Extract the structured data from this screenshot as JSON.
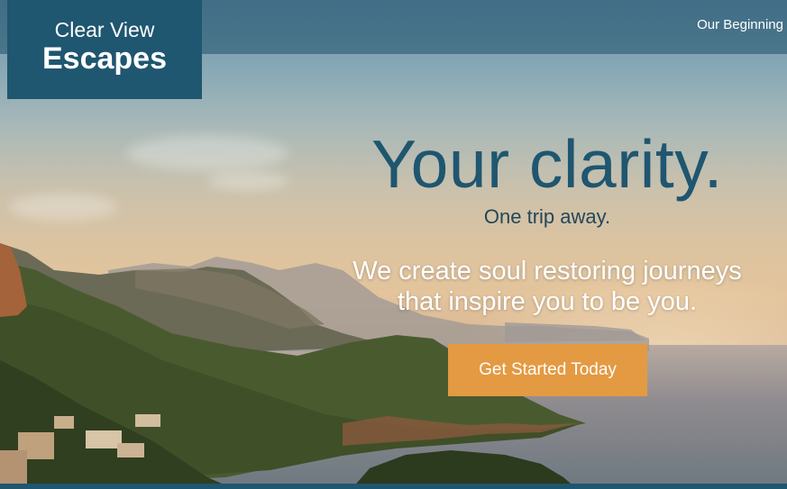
{
  "brand": {
    "line1": "Clear View",
    "line2": "Escapes"
  },
  "nav": {
    "items": [
      "Our Beginning"
    ]
  },
  "hero": {
    "headline": "Your clarity.",
    "subheadline": "One trip away.",
    "tagline_line1": "We create soul restoring journeys",
    "tagline_line2": "that inspire you to be you.",
    "cta_label": "Get Started Today"
  },
  "colors": {
    "brand_navy": "#1f5670",
    "cta_orange": "#e49a42",
    "headline_blue": "#1f5670",
    "white": "#ffffff"
  }
}
